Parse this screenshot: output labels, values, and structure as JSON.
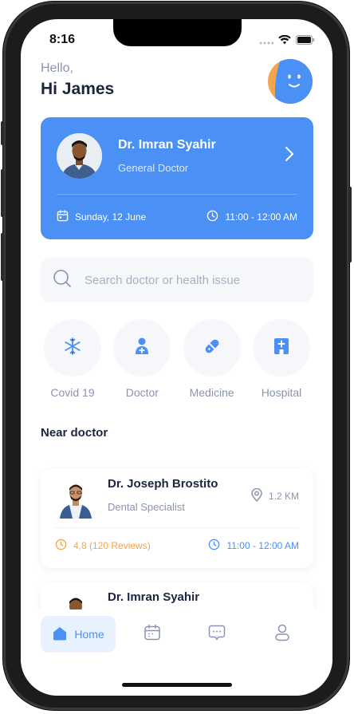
{
  "status": {
    "time": "8:16"
  },
  "greeting": {
    "hello": "Hello,",
    "name": "Hi James"
  },
  "appointment": {
    "doctor_name": "Dr. Imran Syahir",
    "specialty": "General Doctor",
    "date": "Sunday, 12 June",
    "time": "11:00 - 12:00 AM"
  },
  "search": {
    "placeholder": "Search doctor or health issue"
  },
  "categories": [
    {
      "label": "Covid 19",
      "icon": "snowflake-icon"
    },
    {
      "label": "Doctor",
      "icon": "doctor-icon"
    },
    {
      "label": "Medicine",
      "icon": "pill-icon"
    },
    {
      "label": "Hospital",
      "icon": "hospital-icon"
    }
  ],
  "near": {
    "title": "Near doctor",
    "doctors": [
      {
        "name": "Dr. Joseph Brostito",
        "specialty": "Dental Specialist",
        "distance": "1.2 KM",
        "rating": "4,8 (120 Reviews)",
        "time": "11:00 - 12:00 AM"
      },
      {
        "name": "Dr. Imran Syahir"
      }
    ]
  },
  "tabbar": {
    "home_label": "Home"
  },
  "colors": {
    "primary": "#4a90f5",
    "rating": "#f5a54a",
    "muted": "#8a93b0",
    "dark": "#1b2540"
  }
}
